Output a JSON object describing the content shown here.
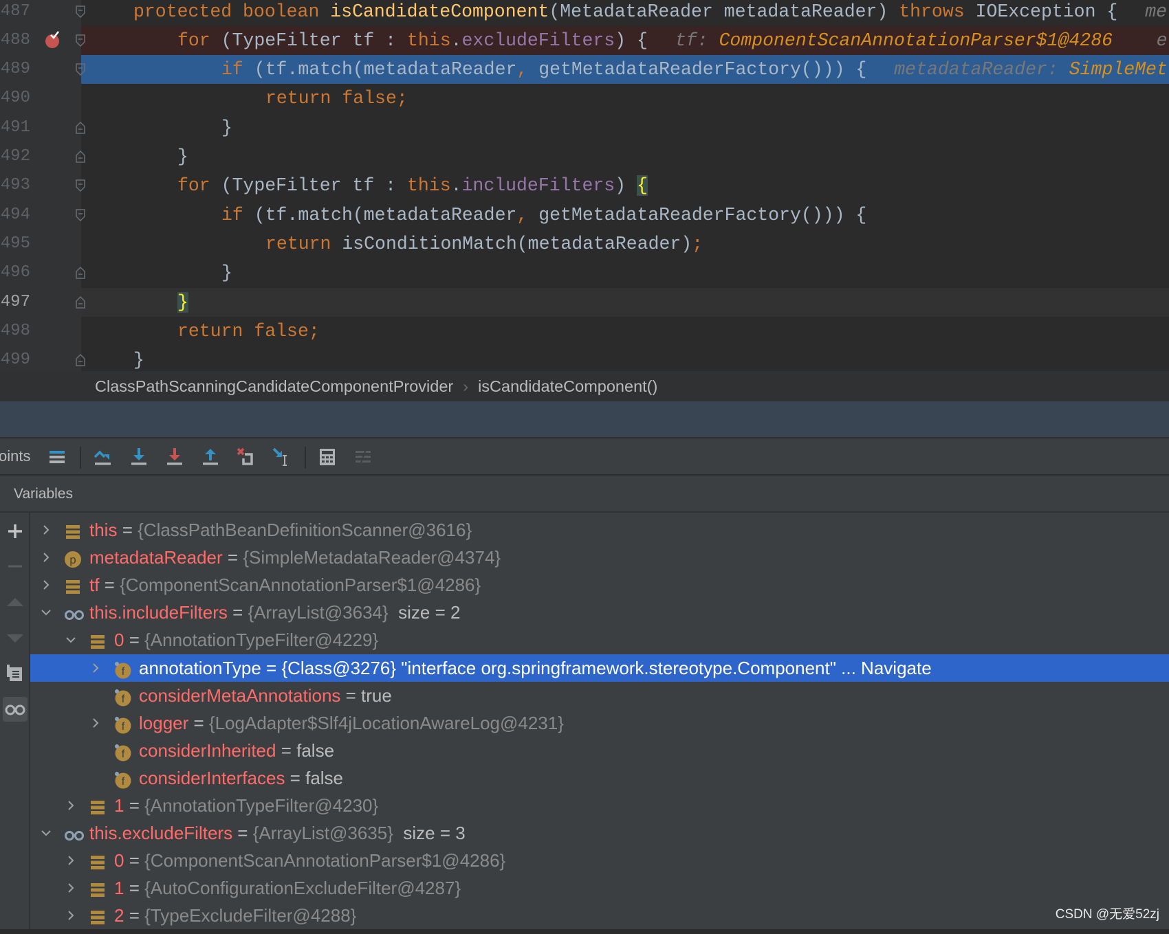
{
  "editor": {
    "lines": [
      {
        "num": "487",
        "indent": 1,
        "tokens": [
          [
            "protected ",
            "kw"
          ],
          [
            "boolean ",
            "kw"
          ],
          [
            "isCandidateComponent",
            "fn"
          ],
          [
            "(MetadataReader metadataReader) ",
            "plain"
          ],
          [
            "throws ",
            "kw"
          ],
          [
            "IOException {",
            "plain"
          ]
        ],
        "hints": [
          [
            "me",
            "hint-k"
          ]
        ]
      },
      {
        "num": "488",
        "indent": 2,
        "tokens": [
          [
            "for ",
            "kw"
          ],
          [
            "(TypeFilter tf : ",
            "plain"
          ],
          [
            "this",
            "kw"
          ],
          [
            ".",
            "plain"
          ],
          [
            "excludeFilters",
            "fld"
          ],
          [
            ") {",
            "plain"
          ]
        ],
        "hints": [
          [
            "tf: ",
            "hint-k"
          ],
          [
            "ComponentScanAnnotationParser$1@4286",
            "hint-v"
          ],
          [
            "    e",
            "hint-k"
          ]
        ],
        "state": "breakpoint"
      },
      {
        "num": "489",
        "indent": 3,
        "tokens": [
          [
            "if ",
            "kw"
          ],
          [
            "(tf.match(metadataReader",
            "plain"
          ],
          [
            ", ",
            "kw"
          ],
          [
            "getMetadataReaderFactory())) {",
            "plain"
          ]
        ],
        "hints": [
          [
            "metadataReader: ",
            "hint-k"
          ],
          [
            "SimpleMet",
            "hint-v"
          ]
        ],
        "state": "execution"
      },
      {
        "num": "490",
        "indent": 4,
        "tokens": [
          [
            "return ",
            "kw"
          ],
          [
            "false",
            "kw"
          ],
          [
            ";",
            "kw"
          ]
        ]
      },
      {
        "num": "491",
        "indent": 3,
        "tokens": [
          [
            "}",
            "plain"
          ]
        ]
      },
      {
        "num": "492",
        "indent": 2,
        "tokens": [
          [
            "}",
            "plain"
          ]
        ]
      },
      {
        "num": "493",
        "indent": 2,
        "tokens": [
          [
            "for ",
            "kw"
          ],
          [
            "(TypeFilter tf : ",
            "plain"
          ],
          [
            "this",
            "kw"
          ],
          [
            ".",
            "plain"
          ],
          [
            "includeFilters",
            "fld"
          ],
          [
            ") ",
            "plain"
          ],
          [
            "{",
            "brace-hl"
          ]
        ]
      },
      {
        "num": "494",
        "indent": 3,
        "tokens": [
          [
            "if ",
            "kw"
          ],
          [
            "(tf.match(metadataReader",
            "plain"
          ],
          [
            ", ",
            "kw"
          ],
          [
            "getMetadataReaderFactory())) {",
            "plain"
          ]
        ]
      },
      {
        "num": "495",
        "indent": 4,
        "tokens": [
          [
            "return ",
            "kw"
          ],
          [
            "isConditionMatch(metadataReader)",
            "plain"
          ],
          [
            ";",
            "kw"
          ]
        ]
      },
      {
        "num": "496",
        "indent": 3,
        "tokens": [
          [
            "}",
            "plain"
          ]
        ]
      },
      {
        "num": "497",
        "indent": 2,
        "tokens": [
          [
            "}",
            "brace-hl"
          ]
        ],
        "state": "caret"
      },
      {
        "num": "498",
        "indent": 2,
        "tokens": [
          [
            "return ",
            "kw"
          ],
          [
            "false",
            "kw"
          ],
          [
            ";",
            "kw"
          ]
        ]
      },
      {
        "num": "499",
        "indent": 1,
        "tokens": [
          [
            "}",
            "plain"
          ]
        ]
      }
    ]
  },
  "breadcrumb": {
    "items": [
      "ClassPathScanningCandidateComponentProvider",
      "isCandidateComponent()"
    ],
    "separator": "›"
  },
  "toolbar": {
    "tab_label_partial": "oints",
    "icons": [
      "show-execution-point-icon",
      "step-over-icon",
      "step-into-icon",
      "force-step-into-icon",
      "step-out-icon",
      "drop-frame-icon",
      "run-to-cursor-icon",
      "evaluate-expression-icon",
      "trace-current-stream-icon"
    ]
  },
  "variables": {
    "title": "Variables",
    "rows": [
      {
        "level": 0,
        "expander": "collapsed",
        "icon": "object",
        "name": "this",
        "value": "{ClassPathBeanDefinitionScanner@3616}"
      },
      {
        "level": 0,
        "expander": "collapsed",
        "icon": "parameter",
        "name": "metadataReader",
        "value": "{SimpleMetadataReader@4374}"
      },
      {
        "level": 0,
        "expander": "collapsed",
        "icon": "object",
        "name": "tf",
        "value": "{ComponentScanAnnotationParser$1@4286}"
      },
      {
        "level": 0,
        "expander": "expanded",
        "icon": "watch",
        "name": "this.includeFilters",
        "value": "{ArrayList@3634}",
        "extra": "size = 2"
      },
      {
        "level": 1,
        "expander": "expanded",
        "icon": "object",
        "name": "0",
        "value": "{AnnotationTypeFilter@4229}"
      },
      {
        "level": 2,
        "expander": "collapsed",
        "icon": "field",
        "name": "annotationType",
        "value": "{Class@3276} \"interface org.springframework.stereotype.Component\" ... Navigate",
        "selected": true
      },
      {
        "level": 2,
        "expander": "none",
        "icon": "field",
        "name": "considerMetaAnnotations",
        "prim": "true"
      },
      {
        "level": 2,
        "expander": "collapsed",
        "icon": "field",
        "name": "logger",
        "value": "{LogAdapter$Slf4jLocationAwareLog@4231}"
      },
      {
        "level": 2,
        "expander": "none",
        "icon": "field",
        "name": "considerInherited",
        "prim": "false"
      },
      {
        "level": 2,
        "expander": "none",
        "icon": "field",
        "name": "considerInterfaces",
        "prim": "false"
      },
      {
        "level": 1,
        "expander": "collapsed",
        "icon": "object",
        "name": "1",
        "value": "{AnnotationTypeFilter@4230}"
      },
      {
        "level": 0,
        "expander": "expanded",
        "icon": "watch",
        "name": "this.excludeFilters",
        "value": "{ArrayList@3635}",
        "extra": "size = 3"
      },
      {
        "level": 1,
        "expander": "collapsed",
        "icon": "object",
        "name": "0",
        "value": "{ComponentScanAnnotationParser$1@4286}"
      },
      {
        "level": 1,
        "expander": "collapsed",
        "icon": "object",
        "name": "1",
        "value": "{AutoConfigurationExcludeFilter@4287}"
      },
      {
        "level": 1,
        "expander": "collapsed",
        "icon": "object",
        "name": "2",
        "value": "{TypeExcludeFilter@4288}"
      }
    ]
  },
  "side_buttons": [
    "add-watch-icon",
    "remove-watch-icon",
    "move-up-icon",
    "move-down-icon",
    "copy-icon",
    "show-watches-icon"
  ],
  "watermark": "CSDN @无爱52zj",
  "colors": {
    "background": "#2b2b2b",
    "breakpoint_line": "#3a2323",
    "execution_line": "#2d5c92",
    "selected_row": "#2e65ca",
    "variable_name": "#ff6b68",
    "keyword": "#cc7832",
    "field": "#9876aa"
  }
}
